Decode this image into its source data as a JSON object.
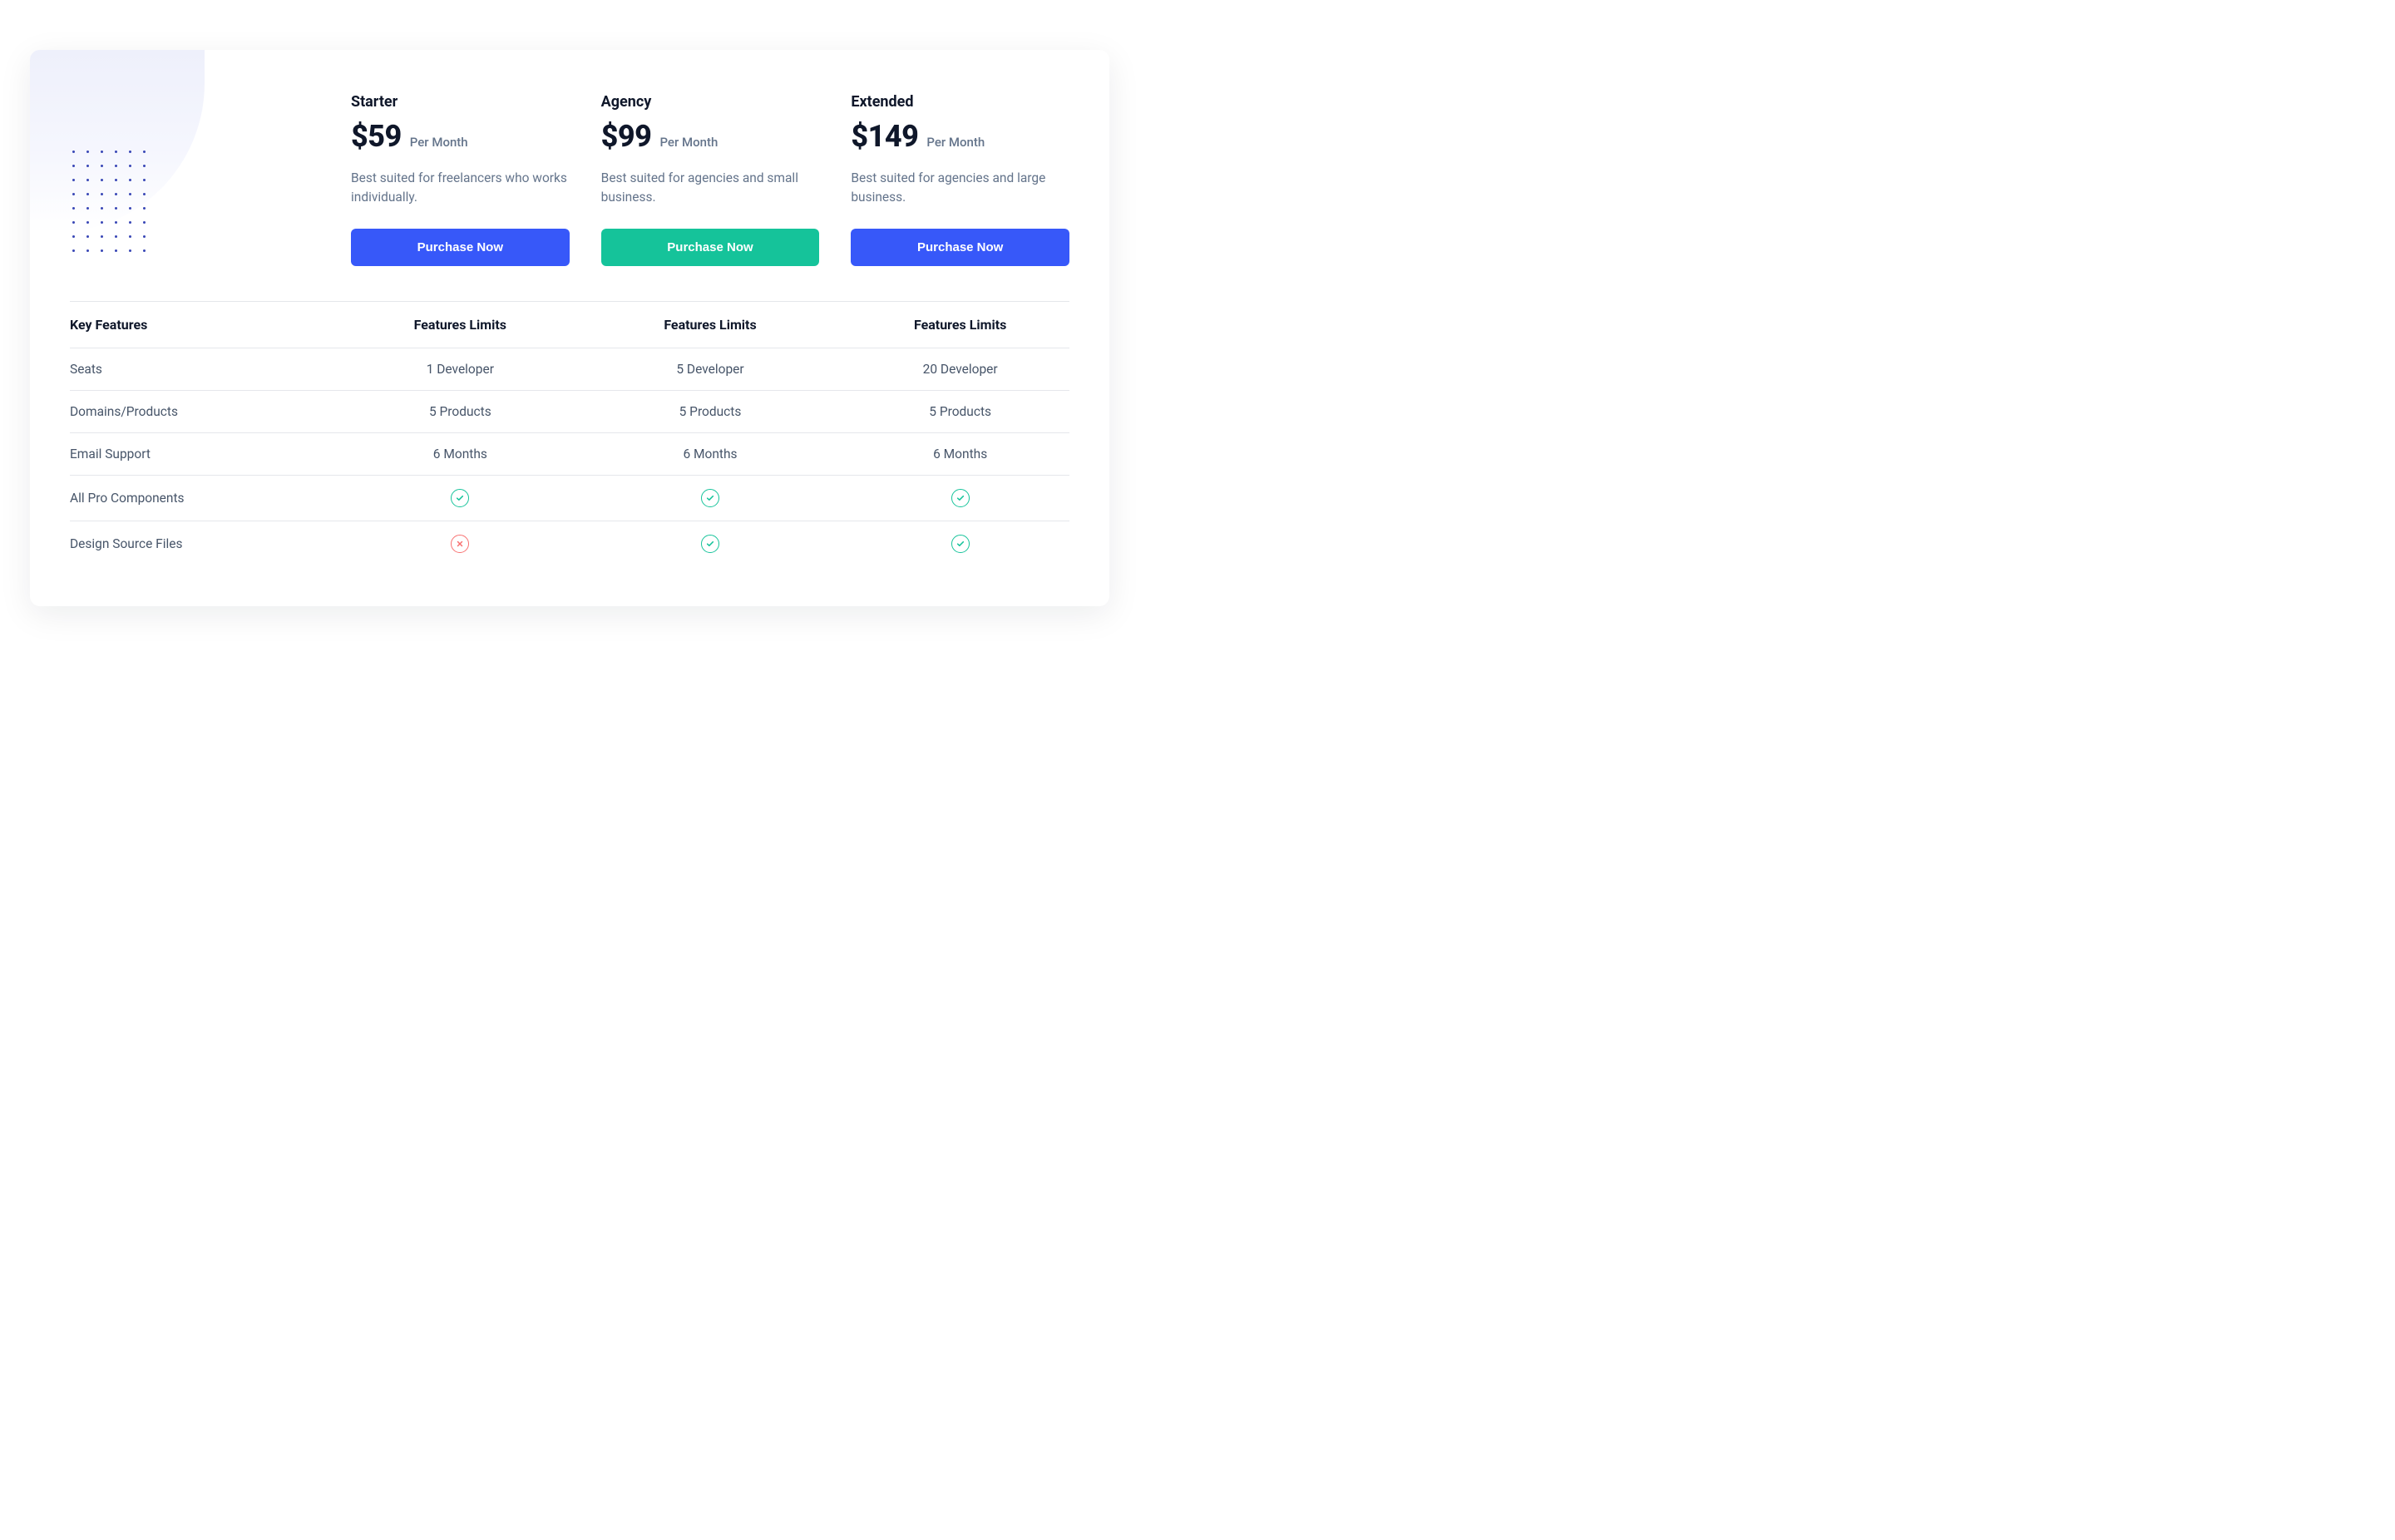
{
  "plans": [
    {
      "name": "Starter",
      "price": "$59",
      "period": "Per Month",
      "desc": "Best suited for freelancers who works individually.",
      "cta": "Purchase Now",
      "cta_style": "blue"
    },
    {
      "name": "Agency",
      "price": "$99",
      "period": "Per Month",
      "desc": "Best suited for agencies and small business.",
      "cta": "Purchase Now",
      "cta_style": "green"
    },
    {
      "name": "Extended",
      "price": "$149",
      "period": "Per Month",
      "desc": "Best suited for agencies and large business.",
      "cta": "Purchase Now",
      "cta_style": "blue"
    }
  ],
  "table": {
    "header": {
      "key": "Key Features",
      "col": "Features Limits"
    },
    "rows": [
      {
        "label": "Seats",
        "cells": [
          "1 Developer",
          "5 Developer",
          "20 Developer"
        ]
      },
      {
        "label": "Domains/Products",
        "cells": [
          "5 Products",
          "5 Products",
          "5 Products"
        ]
      },
      {
        "label": "Email Support",
        "cells": [
          "6 Months",
          "6 Months",
          "6 Months"
        ]
      },
      {
        "label": "All Pro Components",
        "cells": [
          "check",
          "check",
          "check"
        ],
        "icons": true
      },
      {
        "label": "Design Source Files",
        "cells": [
          "cross",
          "check",
          "check"
        ],
        "icons": true
      }
    ]
  },
  "colors": {
    "primary_blue": "#3758f9",
    "primary_green": "#15c39a",
    "red": "#f87171",
    "text_dark": "#0f172a",
    "text_muted": "#64748b"
  }
}
